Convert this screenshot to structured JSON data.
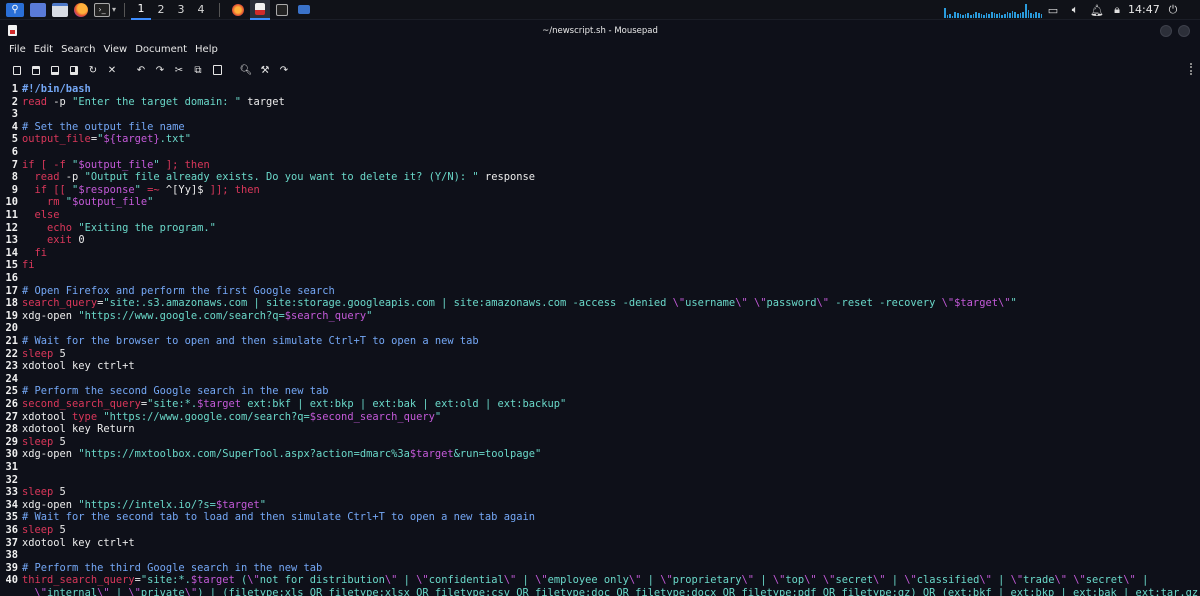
{
  "taskbar": {
    "workspaces": [
      "1",
      "2",
      "3",
      "4"
    ],
    "active_workspace": 0,
    "clock": "14:47",
    "icons": [
      "kali-menu-icon",
      "desktop-icon",
      "file-manager-icon",
      "firefox-icon",
      "terminal-icon"
    ],
    "tray_icons": [
      "display-icon",
      "volume-icon",
      "notification-bell-icon",
      "lock-icon",
      "power-icon"
    ],
    "accent": "#3d8dff"
  },
  "window": {
    "title": "~/newscript.sh - Mousepad"
  },
  "menu": [
    "File",
    "Edit",
    "Search",
    "View",
    "Document",
    "Help"
  ],
  "toolbar": {
    "buttons": [
      "new-document",
      "open-file",
      "save",
      "save-as",
      "reload",
      "close",
      "undo",
      "redo",
      "cut",
      "copy",
      "paste",
      "find",
      "find-replace",
      "go-to-line"
    ]
  },
  "editor": {
    "colors": {
      "comment": "#74a7f5",
      "keyword": "#d9375a",
      "string": "#6ad8c9",
      "variable": "#c45ad9",
      "text": "#ececec",
      "background": "#0e1019"
    },
    "lines": [
      {
        "n": "1",
        "tokens": [
          [
            "shebang",
            "#!/bin/bash"
          ]
        ]
      },
      {
        "n": "2",
        "tokens": [
          [
            "kw",
            "read"
          ],
          [
            "txt",
            " -p "
          ],
          [
            "str",
            "\"Enter the target domain: \""
          ],
          [
            "txt",
            " target"
          ]
        ]
      },
      {
        "n": "3",
        "tokens": []
      },
      {
        "n": "4",
        "tokens": [
          [
            "cmt",
            "# Set the output file name"
          ]
        ]
      },
      {
        "n": "5",
        "tokens": [
          [
            "kw",
            "output_file"
          ],
          [
            "txt",
            "="
          ],
          [
            "str",
            "\""
          ],
          [
            "var",
            "${target}"
          ],
          [
            "str",
            ".txt\""
          ]
        ]
      },
      {
        "n": "6",
        "tokens": []
      },
      {
        "n": "7",
        "tokens": [
          [
            "kw",
            "if [ -f "
          ],
          [
            "str",
            "\""
          ],
          [
            "var",
            "$output_file"
          ],
          [
            "str",
            "\""
          ],
          [
            "kw",
            " ]; then"
          ]
        ]
      },
      {
        "n": "8",
        "tokens": [
          [
            "txt",
            "  "
          ],
          [
            "kw",
            "read"
          ],
          [
            "txt",
            " -p "
          ],
          [
            "str",
            "\"Output file already exists. Do you want to delete it? (Y/N): \""
          ],
          [
            "txt",
            " response"
          ]
        ]
      },
      {
        "n": "9",
        "tokens": [
          [
            "kw",
            "  if [[ "
          ],
          [
            "str",
            "\""
          ],
          [
            "var",
            "$response"
          ],
          [
            "str",
            "\""
          ],
          [
            "kw",
            " =~ "
          ],
          [
            "txt",
            "^[Yy]$"
          ],
          [
            "kw",
            " ]]; then"
          ]
        ]
      },
      {
        "n": "10",
        "tokens": [
          [
            "kw",
            "    rm "
          ],
          [
            "str",
            "\""
          ],
          [
            "var",
            "$output_file"
          ],
          [
            "str",
            "\""
          ]
        ]
      },
      {
        "n": "11",
        "tokens": [
          [
            "kw",
            "  else"
          ]
        ]
      },
      {
        "n": "12",
        "tokens": [
          [
            "kw",
            "    echo "
          ],
          [
            "str",
            "\"Exiting the program.\""
          ]
        ]
      },
      {
        "n": "13",
        "tokens": [
          [
            "kw",
            "    exit "
          ],
          [
            "txt",
            "0"
          ]
        ]
      },
      {
        "n": "14",
        "tokens": [
          [
            "kw",
            "  fi"
          ]
        ]
      },
      {
        "n": "15",
        "tokens": [
          [
            "kw",
            "fi"
          ]
        ]
      },
      {
        "n": "16",
        "tokens": []
      },
      {
        "n": "17",
        "tokens": [
          [
            "cmt",
            "# Open Firefox and perform the first Google search"
          ]
        ]
      },
      {
        "n": "18",
        "tokens": [
          [
            "kw",
            "search_query"
          ],
          [
            "txt",
            "="
          ],
          [
            "str",
            "\"site:.s3.amazonaws.com | site:storage.googleapis.com | site:amazonaws.com -access -denied "
          ],
          [
            "var",
            "\\\""
          ],
          [
            "str",
            "username"
          ],
          [
            "var",
            "\\\""
          ],
          [
            "str",
            " "
          ],
          [
            "var",
            "\\\""
          ],
          [
            "str",
            "password"
          ],
          [
            "var",
            "\\\""
          ],
          [
            "str",
            " -reset -recovery "
          ],
          [
            "var",
            "\\\"$target\\\""
          ],
          [
            "str",
            "\""
          ]
        ]
      },
      {
        "n": "19",
        "tokens": [
          [
            "txt",
            "xdg-open "
          ],
          [
            "str",
            "\"https://www.google.com/search?q="
          ],
          [
            "var",
            "$search_query"
          ],
          [
            "str",
            "\""
          ]
        ]
      },
      {
        "n": "20",
        "tokens": []
      },
      {
        "n": "21",
        "tokens": [
          [
            "cmt",
            "# Wait for the browser to open and then simulate Ctrl+T to open a new tab"
          ]
        ]
      },
      {
        "n": "22",
        "tokens": [
          [
            "kw",
            "sleep "
          ],
          [
            "txt",
            "5"
          ]
        ]
      },
      {
        "n": "23",
        "tokens": [
          [
            "txt",
            "xdotool key ctrl+t"
          ]
        ]
      },
      {
        "n": "24",
        "tokens": []
      },
      {
        "n": "25",
        "tokens": [
          [
            "cmt",
            "# Perform the second Google search in the new tab"
          ]
        ]
      },
      {
        "n": "26",
        "tokens": [
          [
            "kw",
            "second_search_query"
          ],
          [
            "txt",
            "="
          ],
          [
            "str",
            "\"site:*."
          ],
          [
            "var",
            "$target"
          ],
          [
            "str",
            " ext:bkf | ext:bkp | ext:bak | ext:old | ext:backup\""
          ]
        ]
      },
      {
        "n": "27",
        "tokens": [
          [
            "txt",
            "xdotool "
          ],
          [
            "kw",
            "type "
          ],
          [
            "str",
            "\"https://www.google.com/search?q="
          ],
          [
            "var",
            "$second_search_query"
          ],
          [
            "str",
            "\""
          ]
        ]
      },
      {
        "n": "28",
        "tokens": [
          [
            "txt",
            "xdotool key Return"
          ]
        ]
      },
      {
        "n": "29",
        "tokens": [
          [
            "kw",
            "sleep "
          ],
          [
            "txt",
            "5"
          ]
        ]
      },
      {
        "n": "30",
        "tokens": [
          [
            "txt",
            "xdg-open "
          ],
          [
            "str",
            "\"https://mxtoolbox.com/SuperTool.aspx?action=dmarc%3a"
          ],
          [
            "var",
            "$target"
          ],
          [
            "str",
            "&run=toolpage\""
          ]
        ]
      },
      {
        "n": "31",
        "tokens": []
      },
      {
        "n": "32",
        "tokens": []
      },
      {
        "n": "33",
        "tokens": [
          [
            "kw",
            "sleep "
          ],
          [
            "txt",
            "5"
          ]
        ]
      },
      {
        "n": "34",
        "tokens": [
          [
            "txt",
            "xdg-open "
          ],
          [
            "str",
            "\"https://intelx.io/?s="
          ],
          [
            "var",
            "$target"
          ],
          [
            "str",
            "\""
          ]
        ]
      },
      {
        "n": "35",
        "tokens": [
          [
            "cmt",
            "# Wait for the second tab to load and then simulate Ctrl+T to open a new tab again"
          ]
        ]
      },
      {
        "n": "36",
        "tokens": [
          [
            "kw",
            "sleep "
          ],
          [
            "txt",
            "5"
          ]
        ]
      },
      {
        "n": "37",
        "tokens": [
          [
            "txt",
            "xdotool key ctrl+t"
          ]
        ]
      },
      {
        "n": "38",
        "tokens": []
      },
      {
        "n": "39",
        "tokens": [
          [
            "cmt",
            "# Perform the third Google search in the new tab"
          ]
        ]
      },
      {
        "n": "40",
        "tokens": [
          [
            "kw",
            "third_search_query"
          ],
          [
            "txt",
            "="
          ],
          [
            "str",
            "\"site:*."
          ],
          [
            "var",
            "$target"
          ],
          [
            "str",
            " ("
          ],
          [
            "var",
            "\\\""
          ],
          [
            "str",
            "not for distribution"
          ],
          [
            "var",
            "\\\""
          ],
          [
            "str",
            " | "
          ],
          [
            "var",
            "\\\""
          ],
          [
            "str",
            "confidential"
          ],
          [
            "var",
            "\\\""
          ],
          [
            "str",
            " | "
          ],
          [
            "var",
            "\\\""
          ],
          [
            "str",
            "employee only"
          ],
          [
            "var",
            "\\\""
          ],
          [
            "str",
            " | "
          ],
          [
            "var",
            "\\\""
          ],
          [
            "str",
            "proprietary"
          ],
          [
            "var",
            "\\\""
          ],
          [
            "str",
            " | "
          ],
          [
            "var",
            "\\\""
          ],
          [
            "str",
            "top"
          ],
          [
            "var",
            "\\\""
          ],
          [
            "str",
            " "
          ],
          [
            "var",
            "\\\""
          ],
          [
            "str",
            "secret"
          ],
          [
            "var",
            "\\\""
          ],
          [
            "str",
            " | "
          ],
          [
            "var",
            "\\\""
          ],
          [
            "str",
            "classified"
          ],
          [
            "var",
            "\\\""
          ],
          [
            "str",
            " | "
          ],
          [
            "var",
            "\\\""
          ],
          [
            "str",
            "trade"
          ],
          [
            "var",
            "\\\""
          ],
          [
            "str",
            " "
          ],
          [
            "var",
            "\\\""
          ],
          [
            "str",
            "secret"
          ],
          [
            "var",
            "\\\""
          ],
          [
            "str",
            " |"
          ]
        ]
      },
      {
        "n": "",
        "tokens": [
          [
            "str",
            "  "
          ],
          [
            "var",
            "\\\""
          ],
          [
            "str",
            "internal"
          ],
          [
            "var",
            "\\\""
          ],
          [
            "str",
            " | "
          ],
          [
            "var",
            "\\\""
          ],
          [
            "str",
            "private"
          ],
          [
            "var",
            "\\\""
          ],
          [
            "str",
            ") | (filetype:xls OR filetype:xlsx OR filetype:csv OR filetype:doc OR filetype:docx OR filetype:pdf OR filetype:gz) OR (ext:bkf | ext:bkp | ext:bak | ext:tar.gz"
          ]
        ]
      }
    ]
  }
}
